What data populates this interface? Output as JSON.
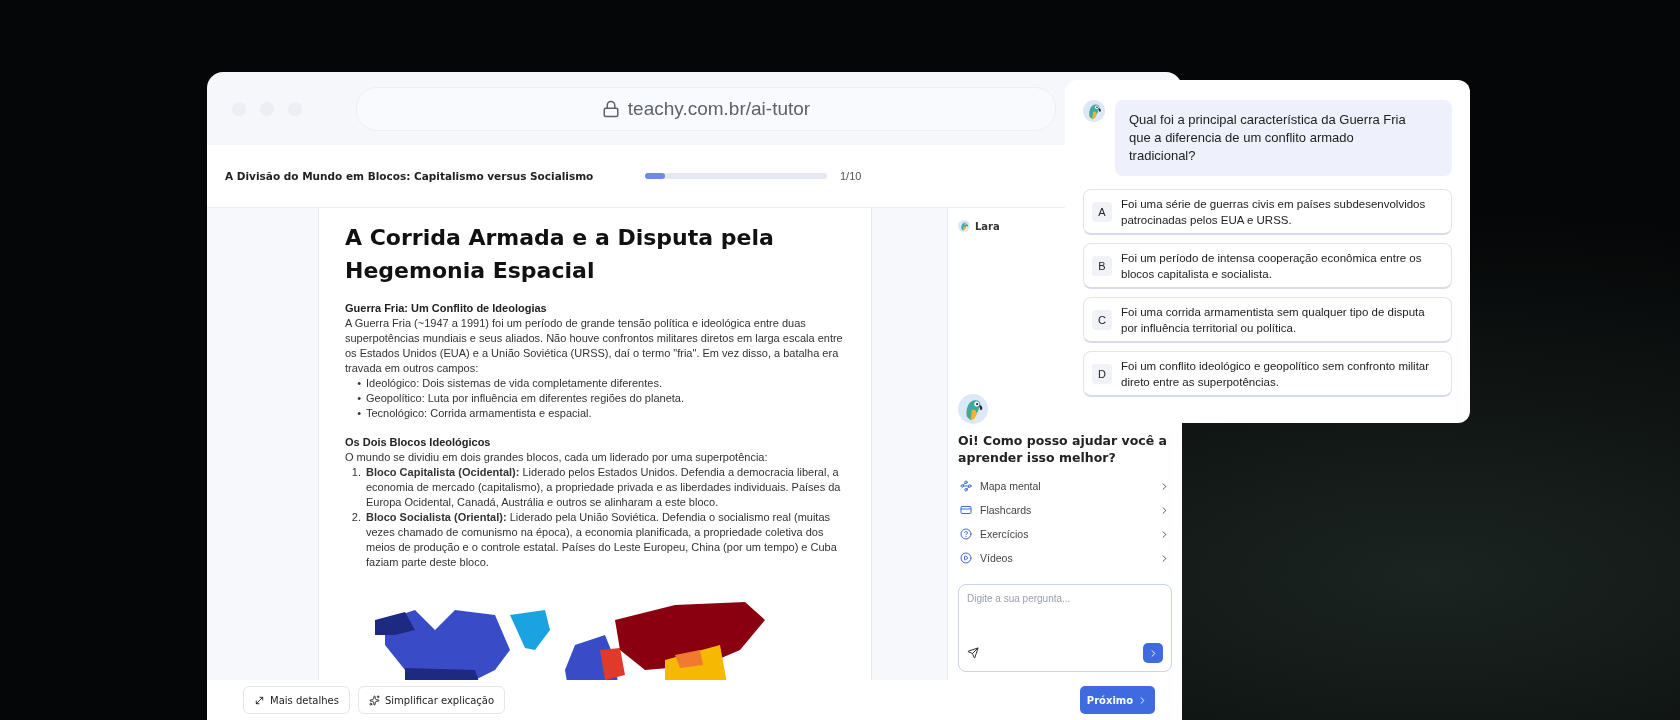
{
  "browser": {
    "url": "teachy.com.br/ai-tutor"
  },
  "header": {
    "title": "A Divisão do Mundo em Blocos: Capitalismo versus Socialismo",
    "progress": {
      "level": 0.11,
      "label": "1/10"
    }
  },
  "document": {
    "title": "A Corrida Armada e a Disputa pela Hegemonia Espacial",
    "sections": [
      {
        "heading": "Guerra Fria: Um Conflito de Ideologias",
        "paragraph": "A Guerra Fria (~1947 a 1991) foi um período de grande tensão política e ideológica entre duas superpotências mundiais e seus aliados. Não houve confrontos militares diretos em larga escala entre os Estados Unidos (EUA) e a União Soviética (URSS), daí o termo \"fria\". Em vez disso, a batalha era travada em outros campos:",
        "items": [
          {
            "marker": "•",
            "text": "Ideológico: Dois sistemas de vida completamente diferentes."
          },
          {
            "marker": "•",
            "text": "Geopolítico: Luta por influência em diferentes regiões do planeta."
          },
          {
            "marker": "•",
            "text": "Tecnológico: Corrida armamentista e espacial."
          }
        ]
      },
      {
        "heading": "Os Dois Blocos Ideológicos",
        "paragraph": "O mundo se dividiu em dois grandes blocos, cada um liderado por uma superpotência:",
        "items": [
          {
            "marker": "1.",
            "text": "**Bloco Capitalista (Ocidental):** Liderado pelos Estados Unidos. Defendia a democracia liberal, a economia de mercado (capitalismo), a propriedade privada e as liberdades individuais. Países da Europa Ocidental, Canadá, Austrália e outros se alinharam a este bloco."
          },
          {
            "marker": "2.",
            "text": "**Bloco Socialista (Oriental):** Liderado pela União Soviética. Defendia o socialismo real (muitas vezes chamado de comunismo na época), a economia planificada, a propriedade coletiva dos meios de produção e o controle estatal. Países do Leste Europeu, China (por um tempo) e Cuba faziam parte deste bloco."
          }
        ]
      }
    ]
  },
  "assistant": {
    "name": "Lara",
    "greeting": "Oi! Como posso ajudar você a aprender isso melhor?",
    "options": [
      {
        "kind": "mindmap",
        "label": "Mapa mental"
      },
      {
        "kind": "flashcards",
        "label": "Flashcards"
      },
      {
        "kind": "exercises",
        "label": "Exercícios"
      },
      {
        "kind": "videos",
        "label": "Vídeos"
      }
    ],
    "input": {
      "placeholder": "Digite a sua pergunta..."
    }
  },
  "actions": [
    {
      "kind": "expand",
      "label": "Mais detalhes"
    },
    {
      "kind": "sparkle",
      "label": "Simplificar explicação"
    }
  ],
  "next_button": "Próximo",
  "quiz": {
    "question": "Qual foi a principal característica da Guerra Fria que a diferencia de um conflito armado tradicional?",
    "answers": [
      {
        "letter": "A",
        "text": "Foi uma série de guerras civis em países subdesenvolvidos patrocinadas pelos EUA e URSS."
      },
      {
        "letter": "B",
        "text": "Foi um período de intensa cooperação econômica entre os blocos capitalista e socialista."
      },
      {
        "letter": "C",
        "text": "Foi uma corrida armamentista sem qualquer tipo de disputa por influência territorial ou política."
      },
      {
        "letter": "D",
        "text": "Foi um conflito ideológico e geopolítico sem confronto militar direto entre as superpotências."
      }
    ]
  }
}
